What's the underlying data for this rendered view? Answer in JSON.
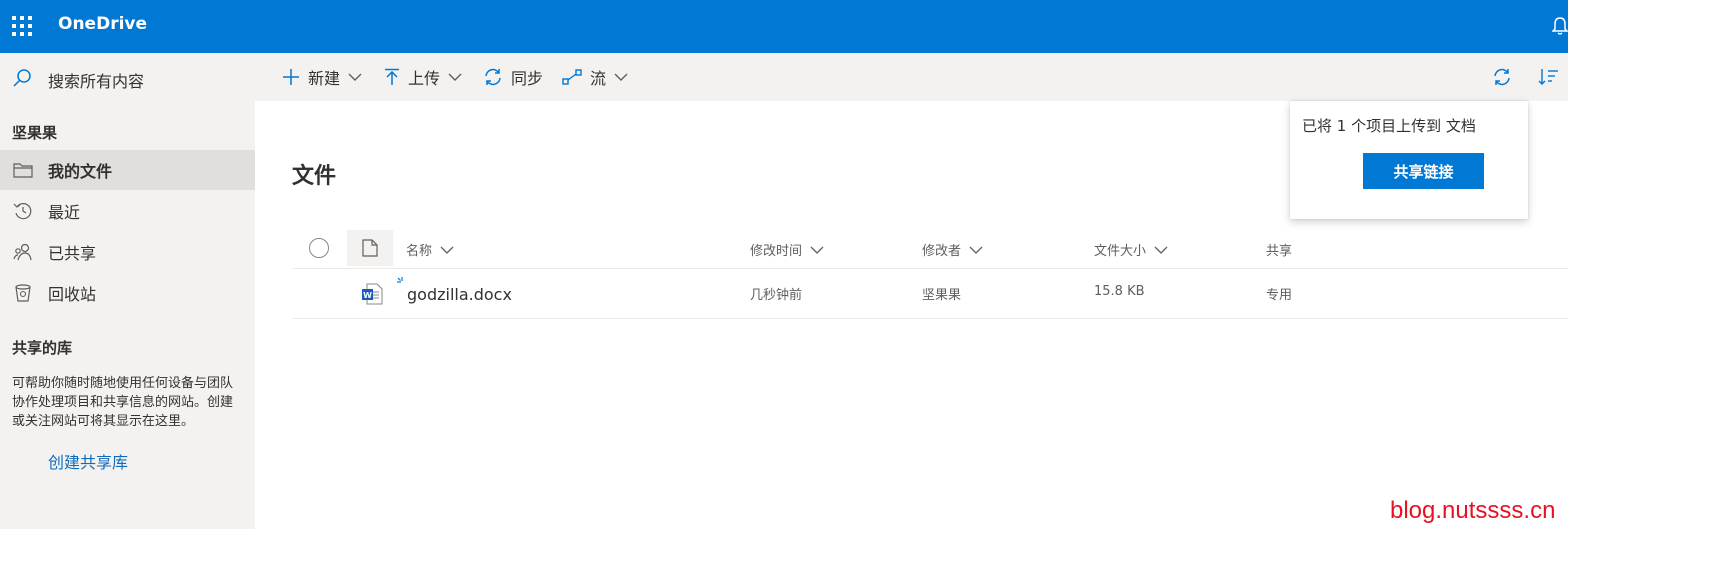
{
  "app": {
    "title": "OneDrive"
  },
  "search": {
    "label": "搜索所有内容"
  },
  "commands": {
    "new": "新建",
    "upload": "上传",
    "sync": "同步",
    "flow": "流"
  },
  "nav": {
    "user_heading": "坚果果",
    "items": [
      {
        "label": "我的文件",
        "icon": "folder-icon",
        "selected": true
      },
      {
        "label": "最近",
        "icon": "history-icon",
        "selected": false
      },
      {
        "label": "已共享",
        "icon": "people-icon",
        "selected": false
      },
      {
        "label": "回收站",
        "icon": "recycle-bin-icon",
        "selected": false
      }
    ],
    "shared_heading": "共享的库",
    "shared_description": "可帮助你随时随地使用任何设备与团队协作处理项目和共享信息的网站。创建或关注网站可将其显示在这里。",
    "create_link": "创建共享库"
  },
  "main": {
    "title": "文件",
    "columns": [
      "名称",
      "修改时间",
      "修改者",
      "文件大小",
      "共享"
    ],
    "rows": [
      {
        "name": "godzilla.docx",
        "modified": "几秒钟前",
        "modified_by": "坚果果",
        "size": "15.8 KB",
        "sharing": "专用"
      }
    ]
  },
  "toast": {
    "message": "已将 1 个项目上传到 文档",
    "button": "共享链接"
  },
  "watermark": "blog.nutssss.cn",
  "colors": {
    "brand": "#0078d4",
    "link": "#0f6cbd",
    "watermark": "#e81123"
  }
}
